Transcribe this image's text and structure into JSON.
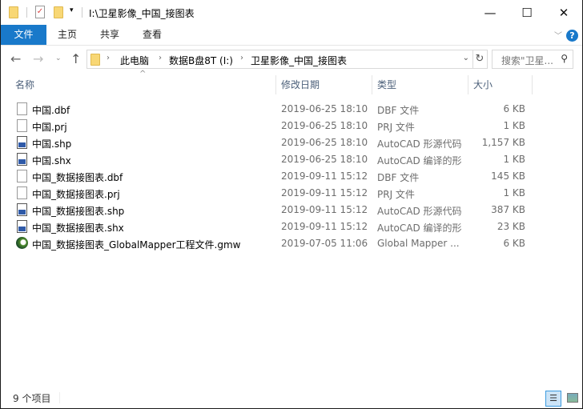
{
  "window": {
    "title": "I:\\卫星影像_中国_接图表"
  },
  "ribbon": {
    "tabs": [
      {
        "label": "文件"
      },
      {
        "label": "主页"
      },
      {
        "label": "共享"
      },
      {
        "label": "查看"
      }
    ],
    "help_label": "?"
  },
  "address": {
    "crumbs": [
      "此电脑",
      "数据B盘8T (I:)",
      "卫星影像_中国_接图表"
    ]
  },
  "search": {
    "placeholder": "搜索\"卫星... "
  },
  "columns": {
    "name": "名称",
    "date": "修改日期",
    "type": "类型",
    "size": "大小"
  },
  "files": [
    {
      "name": "中国.dbf",
      "date": "2019-06-25 18:10",
      "type": "DBF 文件",
      "size": "6 KB",
      "icon": "file"
    },
    {
      "name": "中国.prj",
      "date": "2019-06-25 18:10",
      "type": "PRJ 文件",
      "size": "1 KB",
      "icon": "file"
    },
    {
      "name": "中国.shp",
      "date": "2019-06-25 18:10",
      "type": "AutoCAD 形源代码",
      "size": "1,157 KB",
      "icon": "cad"
    },
    {
      "name": "中国.shx",
      "date": "2019-06-25 18:10",
      "type": "AutoCAD 编译的形",
      "size": "1 KB",
      "icon": "cad"
    },
    {
      "name": "中国_数据接图表.dbf",
      "date": "2019-09-11 15:12",
      "type": "DBF 文件",
      "size": "145 KB",
      "icon": "file"
    },
    {
      "name": "中国_数据接图表.prj",
      "date": "2019-09-11 15:12",
      "type": "PRJ 文件",
      "size": "1 KB",
      "icon": "file"
    },
    {
      "name": "中国_数据接图表.shp",
      "date": "2019-09-11 15:12",
      "type": "AutoCAD 形源代码",
      "size": "387 KB",
      "icon": "cad"
    },
    {
      "name": "中国_数据接图表.shx",
      "date": "2019-09-11 15:12",
      "type": "AutoCAD 编译的形",
      "size": "23 KB",
      "icon": "cad"
    },
    {
      "name": "中国_数据接图表_GlobalMapper工程文件.gmw",
      "date": "2019-07-05 11:06",
      "type": "Global Mapper ...",
      "size": "6 KB",
      "icon": "gm"
    }
  ],
  "status": {
    "count": "9 个项目"
  }
}
